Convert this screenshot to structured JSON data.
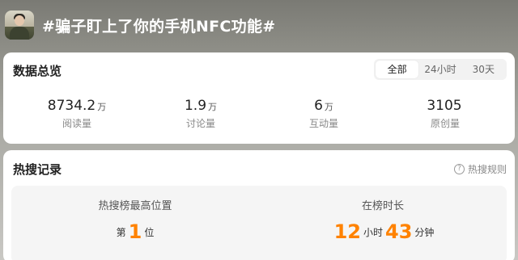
{
  "topic": {
    "title": "#骗子盯上了你的手机NFC功能#"
  },
  "overview": {
    "title": "数据总览",
    "tabs": [
      {
        "label": "全部",
        "active": true
      },
      {
        "label": "24小时",
        "active": false
      },
      {
        "label": "30天",
        "active": false
      }
    ],
    "stats": [
      {
        "value": "8734.2",
        "unit": "万",
        "label": "阅读量"
      },
      {
        "value": "1.9",
        "unit": "万",
        "label": "讨论量"
      },
      {
        "value": "6",
        "unit": "万",
        "label": "互动量"
      },
      {
        "value": "3105",
        "unit": "",
        "label": "原创量"
      }
    ]
  },
  "hot_search": {
    "title": "热搜记录",
    "rules_label": "热搜规则",
    "rules_icon": "question-circle-icon",
    "highest_position": {
      "label": "热搜榜最高位置",
      "prefix": "第",
      "value": "1",
      "suffix": "位"
    },
    "duration": {
      "label": "在榜时长",
      "hours": "12",
      "hours_unit": "小时",
      "minutes": "43",
      "minutes_unit": "分钟"
    }
  },
  "colors": {
    "accent": "#ff8200",
    "card_bg": "#ffffff",
    "panel_bg": "#f5f5f5"
  }
}
